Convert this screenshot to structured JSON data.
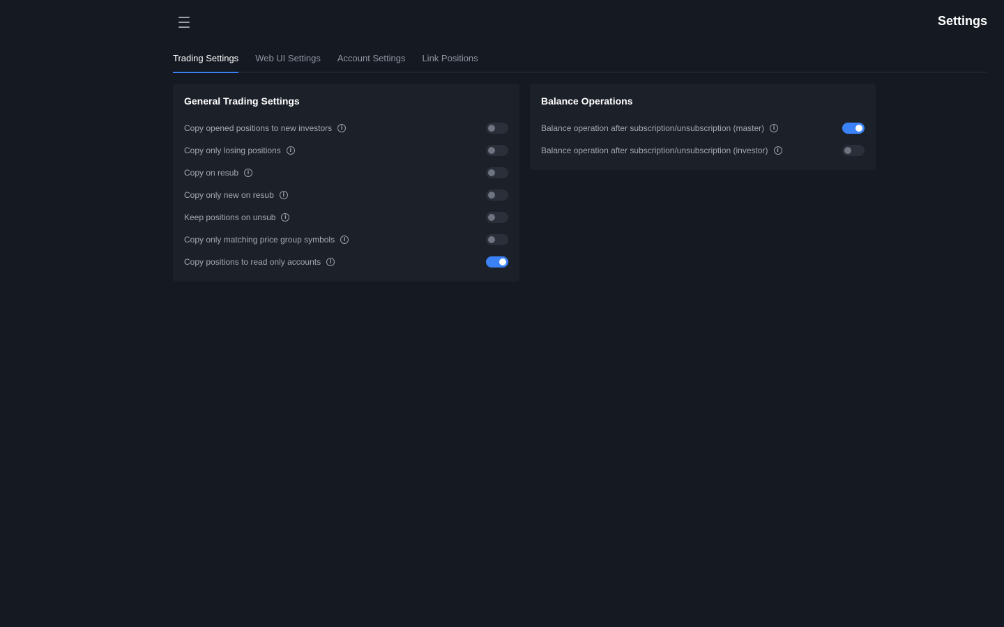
{
  "header": {
    "menu_icon": "hamburger-menu-icon",
    "title": "Settings"
  },
  "tabs": [
    {
      "label": "Trading Settings",
      "active": true
    },
    {
      "label": "Web UI Settings",
      "active": false
    },
    {
      "label": "Account Settings",
      "active": false
    },
    {
      "label": "Link Positions",
      "active": false
    }
  ],
  "general": {
    "title": "General Trading Settings",
    "items": [
      {
        "label": "Copy opened positions to new investors",
        "on": false
      },
      {
        "label": "Copy only losing positions",
        "on": false
      },
      {
        "label": "Copy on resub",
        "on": false
      },
      {
        "label": "Copy only new on resub",
        "on": false
      },
      {
        "label": "Keep positions on unsub",
        "on": false
      },
      {
        "label": "Copy only matching price group symbols",
        "on": false
      },
      {
        "label": "Copy positions to read only accounts",
        "on": true
      }
    ]
  },
  "balance": {
    "title": "Balance Operations",
    "items": [
      {
        "label": "Balance operation after subscription/unsubscription (master)",
        "on": true
      },
      {
        "label": "Balance operation after subscription/unsubscription (investor)",
        "on": false
      }
    ]
  },
  "colors": {
    "background": "#151922",
    "card": "#1c2029",
    "accent": "#3b82f6",
    "toggle_off": "#2a2f39"
  }
}
